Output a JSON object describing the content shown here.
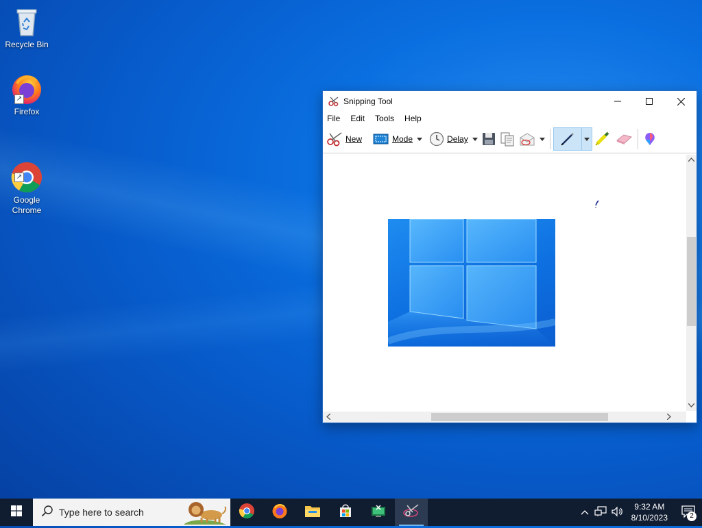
{
  "desktop": {
    "icons": [
      {
        "label": "Recycle Bin"
      },
      {
        "label": "Firefox"
      },
      {
        "label": "Google\nChrome"
      }
    ]
  },
  "window": {
    "title": "Snipping Tool",
    "menu": [
      "File",
      "Edit",
      "Tools",
      "Help"
    ],
    "toolbar": {
      "new_label": "New",
      "mode_label": "Mode",
      "delay_label": "Delay"
    }
  },
  "taskbar": {
    "search_placeholder": "Type here to search",
    "time": "9:32 AM",
    "date": "8/10/2023",
    "notification_count": "2"
  },
  "colors": {
    "desktop_blue": "#0a6fe0",
    "taskbar": "#101c30",
    "window_border": "#2b6cc4"
  }
}
